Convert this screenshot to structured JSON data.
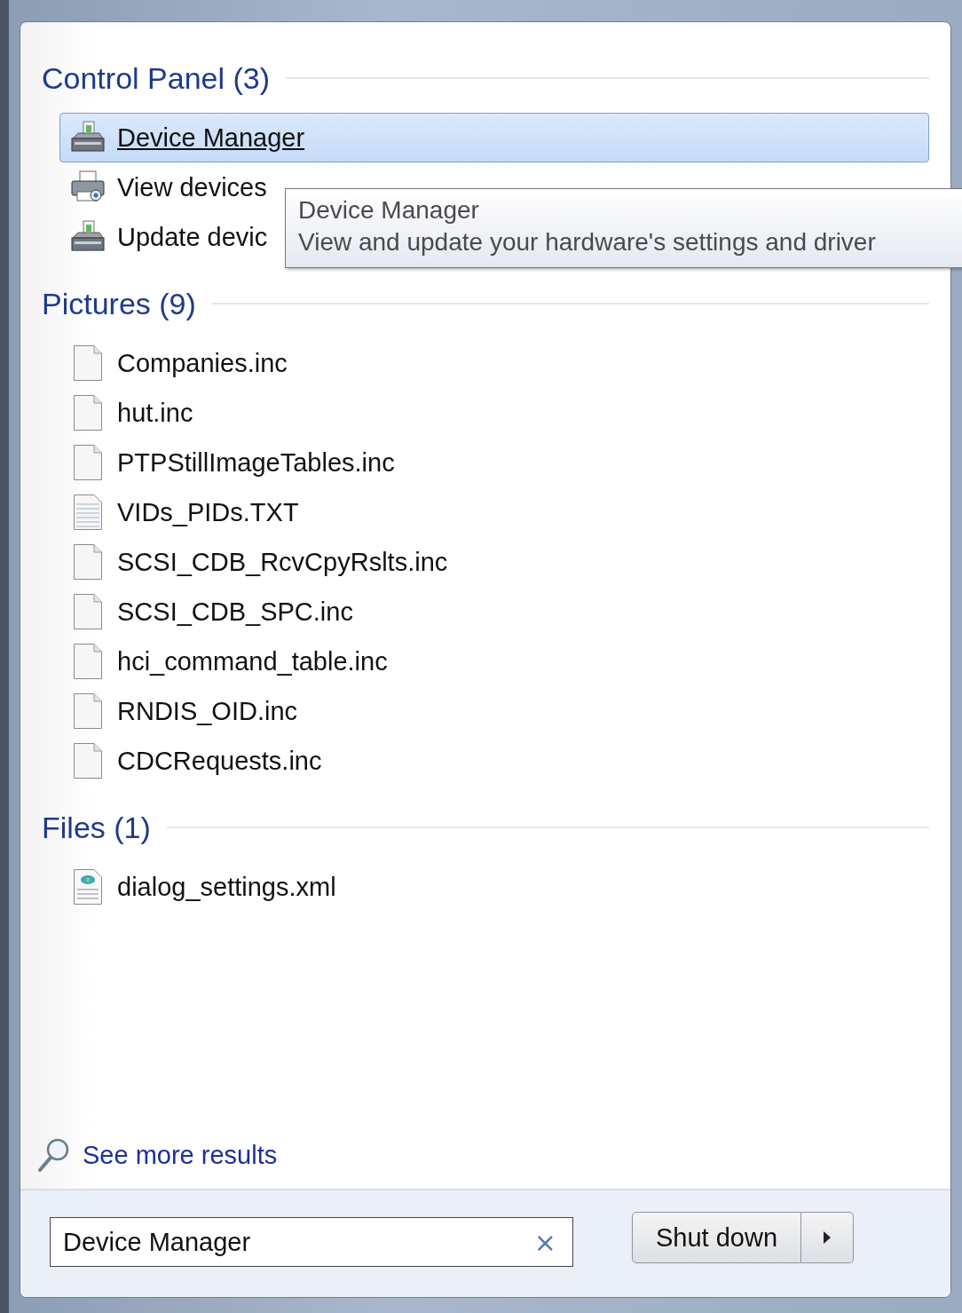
{
  "sections": [
    {
      "title": "Control Panel (3)",
      "items": [
        {
          "label": "Device Manager",
          "kind": "device",
          "selected": true
        },
        {
          "label": "View devices",
          "kind": "printer",
          "selected": false
        },
        {
          "label": "Update devic",
          "kind": "device",
          "selected": false
        }
      ]
    },
    {
      "title": "Pictures (9)",
      "items": [
        {
          "label": "Companies.inc",
          "kind": "file",
          "selected": false
        },
        {
          "label": "hut.inc",
          "kind": "file",
          "selected": false
        },
        {
          "label": "PTPStillImageTables.inc",
          "kind": "file",
          "selected": false
        },
        {
          "label": "VIDs_PIDs.TXT",
          "kind": "text",
          "selected": false
        },
        {
          "label": "SCSI_CDB_RcvCpyRslts.inc",
          "kind": "file",
          "selected": false
        },
        {
          "label": "SCSI_CDB_SPC.inc",
          "kind": "file",
          "selected": false
        },
        {
          "label": "hci_command_table.inc",
          "kind": "file",
          "selected": false
        },
        {
          "label": "RNDIS_OID.inc",
          "kind": "file",
          "selected": false
        },
        {
          "label": "CDCRequests.inc",
          "kind": "file",
          "selected": false
        }
      ]
    },
    {
      "title": "Files (1)",
      "items": [
        {
          "label": "dialog_settings.xml",
          "kind": "xml",
          "selected": false
        }
      ]
    }
  ],
  "tooltip": {
    "title": "Device Manager",
    "description": "View and update your hardware's settings and driver"
  },
  "see_more": "See more results",
  "search": {
    "value": "Device Manager",
    "clear": "×"
  },
  "shutdown": {
    "label": "Shut down"
  }
}
